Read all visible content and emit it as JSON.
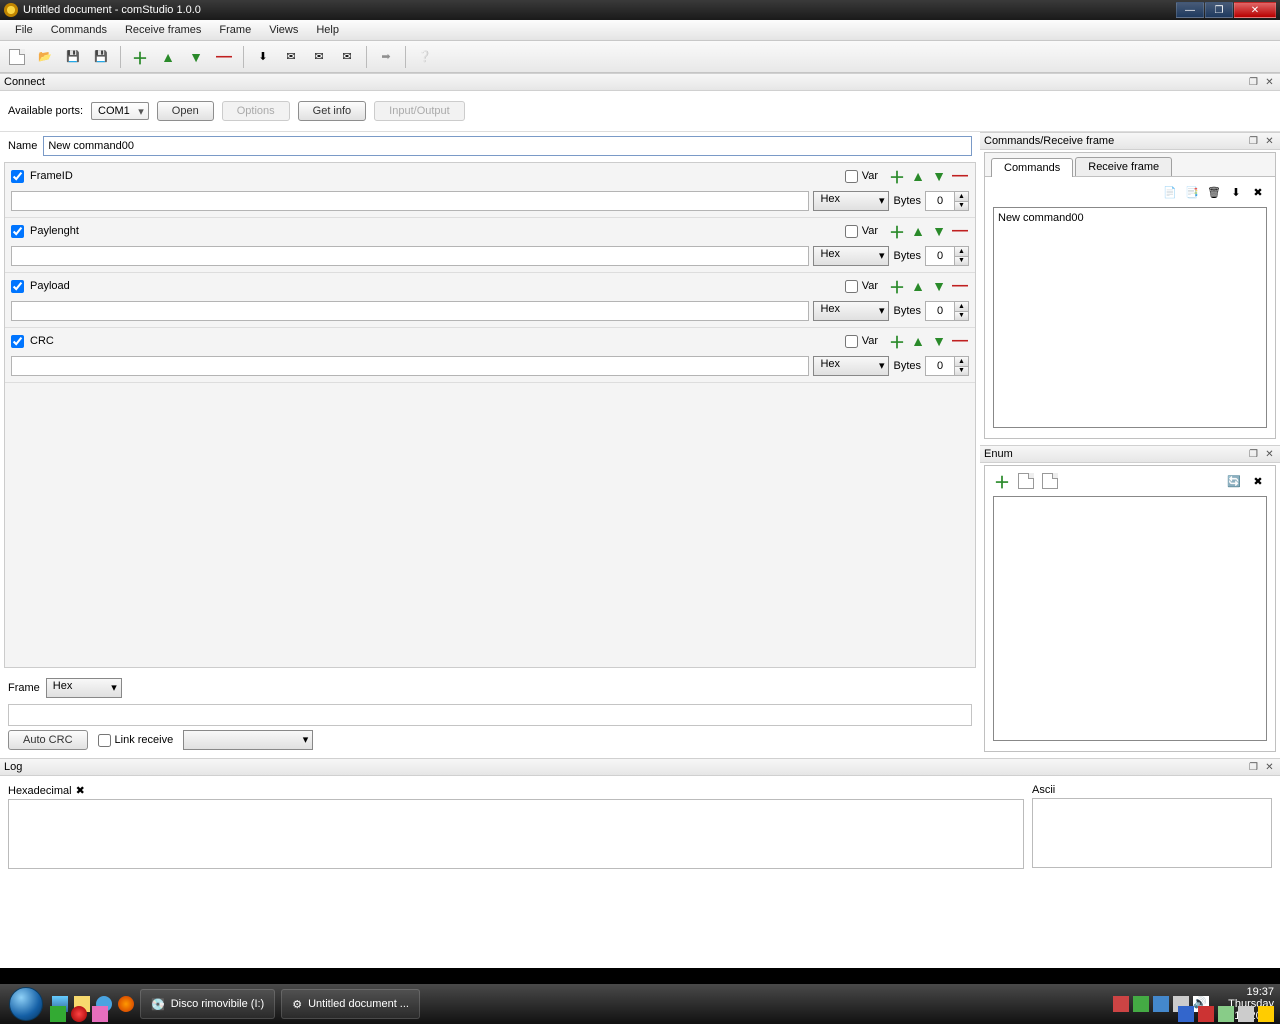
{
  "titlebar": {
    "title": "Untitled document - comStudio 1.0.0"
  },
  "menu": {
    "items": [
      "File",
      "Commands",
      "Receive frames",
      "Frame",
      "Views",
      "Help"
    ]
  },
  "panels": {
    "connect": "Connect",
    "commandsReceive": "Commands/Receive frame",
    "enum": "Enum",
    "log": "Log"
  },
  "connect": {
    "availablePorts": "Available ports:",
    "port": "COM1",
    "open": "Open",
    "options": "Options",
    "getinfo": "Get info",
    "io": "Input/Output"
  },
  "editor": {
    "nameLabel": "Name",
    "nameValue": "New command00",
    "var": "Var",
    "bytes": "Bytes",
    "hex": "Hex",
    "fields": [
      {
        "label": "FrameID",
        "bytes": "0"
      },
      {
        "label": "Paylenght",
        "bytes": "0"
      },
      {
        "label": "Payload",
        "bytes": "0"
      },
      {
        "label": "CRC",
        "bytes": "0"
      }
    ],
    "frameLabel": "Frame",
    "frameFmt": "Hex",
    "autoCrc": "Auto CRC",
    "linkReceive": "Link receive"
  },
  "right": {
    "tabCommands": "Commands",
    "tabReceive": "Receive frame",
    "listItems": [
      "New command00"
    ]
  },
  "log": {
    "hexLabel": "Hexadecimal",
    "asciiLabel": "Ascii"
  },
  "taskbar": {
    "item1": "Disco rimovibile (I:)",
    "item2": "Untitled document ...",
    "time": "19:37",
    "day": "Thursday",
    "date": "27/12/2012"
  }
}
